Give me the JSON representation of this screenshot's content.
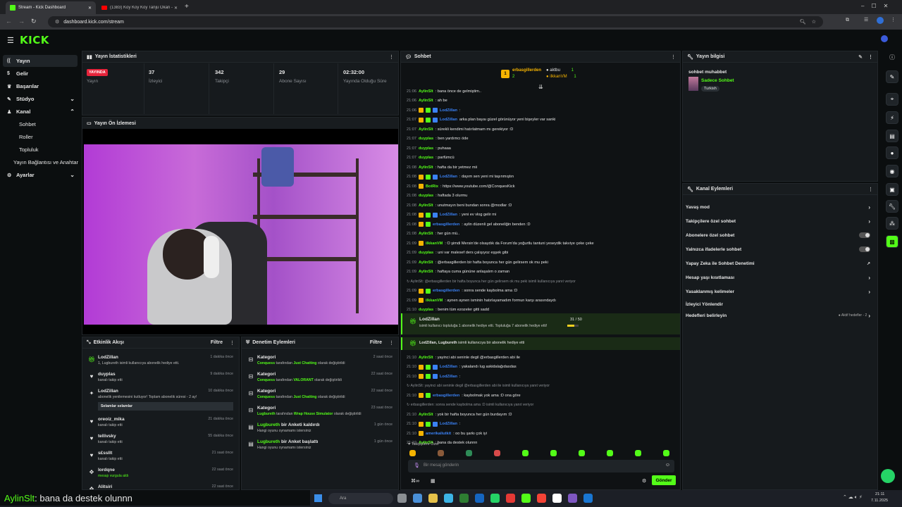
{
  "browser": {
    "tabs": [
      {
        "title": "Stream - Kick Dashboard",
        "active": true
      },
      {
        "title": "(1383) Koy Koy Koy Tanju Okan -",
        "active": false
      }
    ],
    "new_tab": "+",
    "url": "dashboard.kick.com/stream",
    "nav_icons": [
      "back-icon",
      "forward-icon",
      "reload-icon"
    ]
  },
  "logo": "KICK",
  "sidebar": {
    "items": [
      {
        "label": "Yayın",
        "icon": "broadcast-icon",
        "active": true
      },
      {
        "label": "Gelir",
        "icon": "dollar-icon"
      },
      {
        "label": "Başarılar",
        "icon": "trophy-icon"
      },
      {
        "label": "Stüdyo",
        "icon": "studio-icon",
        "chevron": "down"
      },
      {
        "label": "Kanal",
        "icon": "user-icon",
        "chevron": "up"
      },
      {
        "label": "Sohbet",
        "sub": true
      },
      {
        "label": "Roller",
        "sub": true
      },
      {
        "label": "Topluluk",
        "sub": true
      },
      {
        "label": "Yayın Bağlantısı ve Anahtar",
        "sub": true
      },
      {
        "label": "Ayarlar",
        "icon": "gear-icon",
        "chevron": "down"
      }
    ]
  },
  "stats": {
    "title": "Yayın İstatistikleri",
    "live_badge": "YAYINDA",
    "live_label": "Yayın",
    "items": [
      {
        "value": "37",
        "label": "İzleyici"
      },
      {
        "value": "342",
        "label": "Takipçi"
      },
      {
        "value": "29",
        "label": "Abone Sayısı"
      },
      {
        "value": "02:32:00",
        "label": "Yayında Olduğu Süre"
      }
    ]
  },
  "preview": {
    "title": "Yayın Ön İzlemesi"
  },
  "activity": {
    "title": "Etkinlik Akışı",
    "filter": "Filtre",
    "events": [
      {
        "name": "LodZillan",
        "desc": "1, Lugbureth isimli kullanıcıya abonelik hediye etti.",
        "time": "1 dakika önce",
        "icon": "gift-icon"
      },
      {
        "name": "duyplas",
        "desc": "kanalı takip etti",
        "time": "9 dakika önce",
        "icon": "heart-icon"
      },
      {
        "name": "LodZillan",
        "desc": "abonelik yenilemesini kutluyor! Toplam abonelik süresi - 2 ay!",
        "time": "10 dakika önce",
        "icon": "star-icon",
        "msg": "Selamlar selamlar"
      },
      {
        "name": "oreoiz_mika",
        "desc": "kanalı takip etti",
        "time": "21 dakika önce",
        "icon": "heart-icon"
      },
      {
        "name": "tellivsky",
        "desc": "kanalı takip etti",
        "time": "55 dakika önce",
        "icon": "heart-icon"
      },
      {
        "name": "s£ssllt",
        "desc": "kanalı takip etti",
        "time": "21 saat önce",
        "icon": "heart-icon"
      },
      {
        "name": "lordqne",
        "desc": "mesajı vurgula aldı",
        "time": "22 saat önce",
        "icon": "highlight-icon"
      },
      {
        "name": "Alitsiri",
        "desc": "",
        "time": "22 saat önce",
        "icon": "highlight-icon"
      }
    ]
  },
  "moderation": {
    "title": "Denetim Eylemleri",
    "filter": "Filtre",
    "events": [
      {
        "name": "Kategori",
        "actor": "Conquess",
        "mid": " tarafından ",
        "target": "Just Chatting",
        "end": " olarak değiştirildi",
        "time": "2 saat önce"
      },
      {
        "name": "Kategori",
        "actor": "Conquess",
        "mid": " tarafından ",
        "target": "VALORANT",
        "end": " olarak değiştirildi",
        "time": "22 saat önce"
      },
      {
        "name": "Kategori",
        "actor": "Conquess",
        "mid": " tarafından ",
        "target": "Just Chatting",
        "end": " olarak değiştirildi",
        "time": "22 saat önce"
      },
      {
        "name": "Kategori",
        "actor": "Lugbureth",
        "mid": " tarafından ",
        "target": "Wrap House Simulator",
        "end": " olarak değiştirildi",
        "time": "23 saat önce"
      },
      {
        "name": "Lugbureth",
        "name2": " bir Anketi kaldırdı",
        "desc": "Hangi oyunu oynamamı istersiniz",
        "time": "1 gün önce"
      },
      {
        "name": "Lugbureth",
        "name2": " bir Anket başlattı",
        "desc": "Hangi oyunu oynamamı istersiniz",
        "time": "1 gün önce"
      }
    ]
  },
  "chat": {
    "title": "Sohbet",
    "leaders": [
      {
        "rank": "1",
        "name": "erbasgillerden",
        "count": "2"
      },
      {
        "rank": "",
        "name": "aktbu",
        "count": "1"
      },
      {
        "rank": "",
        "name": "ilkkanVM",
        "count": "1"
      }
    ],
    "lines": [
      {
        "time": "21:06",
        "user": "AylinSlt",
        "color": "#53fc18",
        "text": ": bana önce de gelmiştim..",
        "badges": 0
      },
      {
        "time": "21:06",
        "user": "AylinSlt",
        "color": "#53fc18",
        "text": ": ah be",
        "badges": 0
      },
      {
        "time": "21:06",
        "user": "LodZillan",
        "color": "#3b82f6",
        "text": ":",
        "badges": 3
      },
      {
        "time": "21:07",
        "user": "LodZillan",
        "color": "#3b82f6",
        "text": " arka plan bayaı güzel görünüyor yeni bişeyler var sanki",
        "badges": 3
      },
      {
        "time": "21:07",
        "user": "AylinSlt",
        "color": "#53fc18",
        "text": ": sürekli kendimi hatırlatmam mı gerekiyor :D",
        "badges": 0
      },
      {
        "time": "21:07",
        "user": "duyplas",
        "color": "#53fc18",
        "text": ": ben yardımcı öde",
        "badges": 0
      },
      {
        "time": "21:07",
        "user": "duyplas",
        "color": "#53fc18",
        "text": ": puhaaa",
        "badges": 0
      },
      {
        "time": "21:07",
        "user": "duyplas",
        "color": "#53fc18",
        "text": ": parfümcü",
        "badges": 0
      },
      {
        "time": "21:08",
        "user": "AylinSlt",
        "color": "#53fc18",
        "text": ": hafta da bir yetmez mii",
        "badges": 0
      },
      {
        "time": "21:08",
        "user": "LodZillan",
        "color": "#3b82f6",
        "text": ": dayım sen yeni mi taşınmıştın",
        "badges": 3
      },
      {
        "time": "21:08",
        "user": "BotRix",
        "color": "#53fc18",
        "text": ": https://www.youtube.com/@ConquesKick",
        "badges": 1
      },
      {
        "time": "21:08",
        "user": "duyplas",
        "color": "#53fc18",
        "text": ": haftada 3 olurmu",
        "badges": 0
      },
      {
        "time": "21:08",
        "user": "AylinSlt",
        "color": "#53fc18",
        "text": ": unutmayın beni bundan sonra @modlar :D",
        "badges": 0
      },
      {
        "time": "21:08",
        "user": "LodZillan",
        "color": "#3b82f6",
        "text": ": yeni ev vlog gelir mi",
        "badges": 3
      },
      {
        "time": "21:08",
        "user": "erbasgillerden",
        "color": "#3b82f6",
        "text": ": aylin düzenli gel aboneliğin benden :D",
        "badges": 2
      },
      {
        "time": "21:08",
        "user": "AylinSlt",
        "color": "#53fc18",
        "text": ": her gün mü..",
        "badges": 0
      },
      {
        "time": "21:09",
        "user": "ilkkanVM",
        "color": "#53fc18",
        "text": ": O şimdi Mersin'de olsaydık da Forum'da yoğurtlu tantuni yeseydik takviye çeke çeke",
        "badges": 1
      },
      {
        "time": "21:09",
        "user": "duyplas",
        "color": "#53fc18",
        "text": ": uni var malesef ders çalışıyoz eşşek gibi",
        "badges": 0
      },
      {
        "time": "21:09",
        "user": "AylinSlt",
        "color": "#53fc18",
        "text": ": @erbasgillerden bir hafta boyunca her gün gelirsem ok mu peki",
        "badges": 0
      },
      {
        "time": "21:09",
        "user": "AylinSlt",
        "color": "#53fc18",
        "text": ": haftaya cuma gününe anlaşalım o zaman",
        "badges": 0
      },
      {
        "time": "",
        "user": "",
        "color": "#8b8f94",
        "text": "↻ AylinSlt: @erbasgillerden bir hafta boyunca her gün gelirsem ok mu peki isimli kullanıcıya yanıt veriyor",
        "badges": 0,
        "reply": true
      },
      {
        "time": "21:09",
        "user": "erbasgillerden",
        "color": "#3b82f6",
        "text": ": sonra sende kaybolma ama :D",
        "badges": 2
      },
      {
        "time": "21:09",
        "user": "ilkkanVM",
        "color": "#53fc18",
        "text": ": aynen aynen isminin hatırlayamadım formun karşı arasındaydı",
        "badges": 1
      },
      {
        "time": "21:10",
        "user": "duyplas",
        "color": "#53fc18",
        "text": ": benim tüm ezozeler gitti sadd",
        "badges": 0
      }
    ],
    "gift_banner": {
      "name": "LodZillan",
      "text": "isimli kullanıcı topluluğa 1 abonelik hediye etti. Topluluğa 7 abonelik hediye etti!",
      "progress": "31 / 50",
      "fraction": 0.62
    },
    "gift2": {
      "name": "LodZillan, Lugbureth",
      "text": " isimli kullanıcıya bir abonelik hediye etti"
    },
    "lines2": [
      {
        "time": "21:10",
        "user": "AylinSlt",
        "color": "#53fc18",
        "text": ": yayinci abi seninle degil @erbasgillerden abi ile",
        "badges": 0
      },
      {
        "time": "21:10",
        "user": "LodZillan",
        "color": "#3b82f6",
        "text": ": yakalandı lug askidalağıdasdas",
        "badges": 3
      },
      {
        "time": "21:10",
        "user": "LodZillan",
        "color": "#3b82f6",
        "text": ":",
        "badges": 3
      },
      {
        "time": "",
        "user": "",
        "color": "#8b8f94",
        "text": "↻ AylinSlt: yayinci abi seninle degil @erbasgillerden abi ile isimli kullanıcıya yanıt veriyor",
        "badges": 0,
        "reply": true
      },
      {
        "time": "21:10",
        "user": "erbasgillerden",
        "color": "#3b82f6",
        "text": ": kaybolmak yok ama :D ona göre",
        "badges": 2
      },
      {
        "time": "",
        "user": "",
        "color": "#8b8f94",
        "text": "↻ erbasgillerden: sonra sende kaybolma ama :D isimli kullanıcıya yanıt veriyor",
        "badges": 0,
        "reply": true
      },
      {
        "time": "21:10",
        "user": "AylinSlt",
        "color": "#53fc18",
        "text": ": yok bir hafta boyunca her gün burdayım :D",
        "badges": 0
      },
      {
        "time": "21:10",
        "user": "LodZillan",
        "color": "#3b82f6",
        "text": ":",
        "badges": 3
      },
      {
        "time": "21:10",
        "user": "amerikaliutkit",
        "color": "#3b82f6",
        "text": ": oo bu şarkı çok iyi",
        "badges": 1
      },
      {
        "time": "21:10",
        "user": "AylinSlt",
        "color": "#53fc18",
        "text": ": bana da destek olunnn",
        "badges": 0
      }
    ],
    "followers_only": "♥ Takipçilere Özel",
    "placeholder": "Bir mesaj gönderin",
    "send": "Gönder"
  },
  "stream_info": {
    "title": "Yayın bilgisi",
    "stream_title": "sohbet muhabbet",
    "category": "Sadece Sohbet",
    "tag": "Turkish"
  },
  "channel_actions": {
    "title": "Kanal Eylemleri",
    "items": [
      {
        "label": "Yavaş mod",
        "control": "arrow"
      },
      {
        "label": "Takipçilere özel sohbet",
        "control": "arrow"
      },
      {
        "label": "Abonelere özel sohbet",
        "control": "toggle"
      },
      {
        "label": "Yalnızca ifadelerle sohbet",
        "control": "toggle"
      },
      {
        "label": "Yapay Zeka ile Sohbet Denetimi",
        "control": "external"
      },
      {
        "label": "Hesap yaşı kısıtlaması",
        "control": "arrow"
      },
      {
        "label": "Yasaklanmış kelimeler",
        "control": "arrow"
      },
      {
        "label": "İzleyici Yönlendir",
        "control": "none"
      },
      {
        "label": "Hedefleri belirleyin",
        "control": "goal",
        "extra": "● Aktif hedefler - 2"
      }
    ]
  },
  "overlay_caption": {
    "user": "AylinSlt",
    "text": ": bana da destek olunnn"
  },
  "taskbar": {
    "search": "Ara",
    "time": "21:11",
    "date": "7.11.2025"
  }
}
